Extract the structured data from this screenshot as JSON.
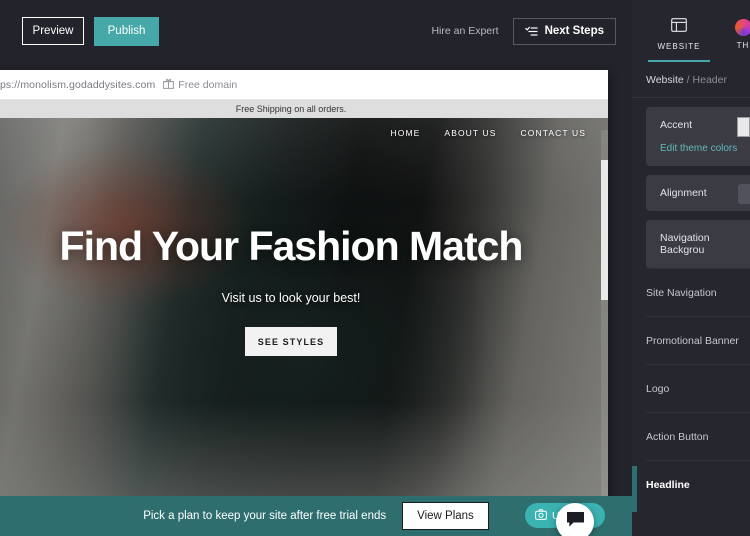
{
  "topbar": {
    "preview_label": "Preview",
    "publish_label": "Publish",
    "hire_expert_label": "Hire an Expert",
    "next_steps_label": "Next Steps",
    "publish_color": "#46a8a8"
  },
  "browser": {
    "url": "https://monolism.godaddysites.com",
    "free_domain_label": "Free domain"
  },
  "site": {
    "promo_banner": "Free Shipping on all orders.",
    "nav": [
      {
        "label": "HOME"
      },
      {
        "label": "ABOUT US"
      },
      {
        "label": "CONTACT US"
      }
    ],
    "headline": "Find Your Fashion Match",
    "subheadline": "Visit us to look your best!",
    "cta_label": "SEE STYLES"
  },
  "overlays": {
    "upgrade_label": "Upgrade",
    "chat_icon": "chat-bubble-icon"
  },
  "trial_banner": {
    "message": "Pick a plan to keep your site after free trial ends",
    "button_label": "View Plans",
    "background": "#2e6e6e"
  },
  "sidebar": {
    "tabs": [
      {
        "label": "WEBSITE",
        "icon": "website-icon",
        "active": true
      },
      {
        "label": "TH",
        "icon": "theme-palette-icon",
        "active": false
      }
    ],
    "breadcrumb": {
      "root": "Website",
      "separator": "/",
      "current": "Header"
    },
    "cards": [
      {
        "label": "Accent",
        "link": "Edit theme colors",
        "swatch": "#e9e9ec"
      },
      {
        "label": "Alignment"
      },
      {
        "label": "Navigation Backgrou"
      }
    ],
    "rows": [
      {
        "label": "Site Navigation",
        "bold": false
      },
      {
        "label": "Promotional Banner",
        "bold": false
      },
      {
        "label": "Logo",
        "bold": false
      },
      {
        "label": "Action Button",
        "bold": false
      },
      {
        "label": "Headline",
        "bold": true
      }
    ]
  }
}
